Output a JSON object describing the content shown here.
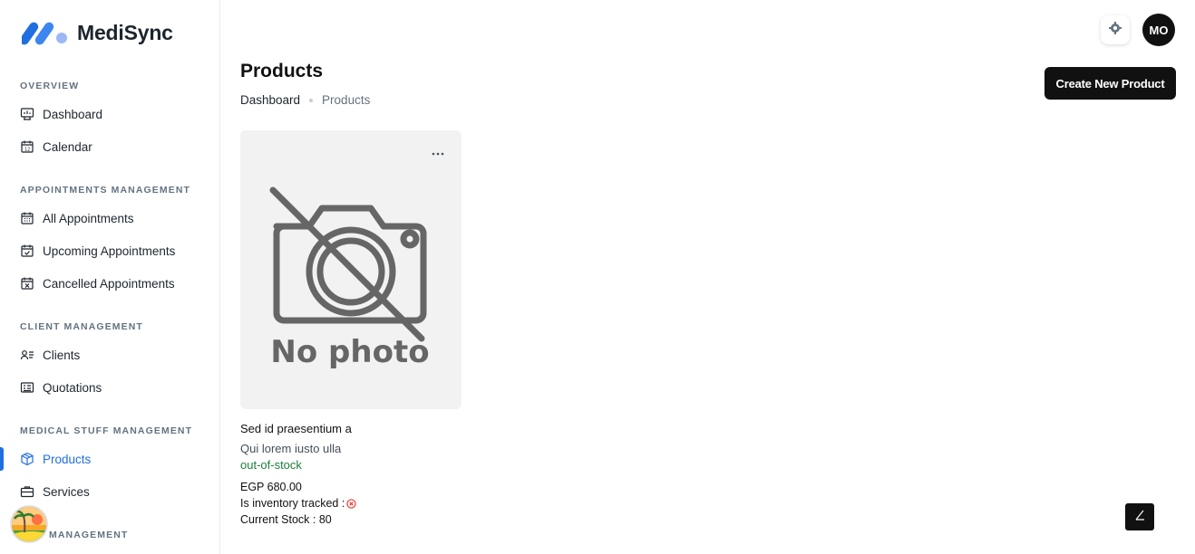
{
  "brand": {
    "name": "MediSync",
    "accent": "#1f6fe0"
  },
  "sidebar": {
    "sections": [
      {
        "label": "OVERVIEW"
      },
      {
        "label": "APPOINTMENTS MANAGEMENT"
      },
      {
        "label": "CLIENT MANAGEMENT"
      },
      {
        "label": "MEDICAL STUFF MANAGEMENT"
      },
      {
        "label": "MANAGEMENT"
      }
    ],
    "items": [
      {
        "label": "Dashboard",
        "icon": "dashboard-icon"
      },
      {
        "label": "Calendar",
        "icon": "calendar-icon"
      },
      {
        "label": "All Appointments",
        "icon": "calendar-grid-icon"
      },
      {
        "label": "Upcoming Appointments",
        "icon": "calendar-check-icon"
      },
      {
        "label": "Cancelled Appointments",
        "icon": "calendar-x-icon"
      },
      {
        "label": "Clients",
        "icon": "users-list-icon"
      },
      {
        "label": "Quotations",
        "icon": "quotation-icon"
      },
      {
        "label": "Products",
        "icon": "box-icon",
        "active": true
      },
      {
        "label": "Services",
        "icon": "briefcase-icon"
      }
    ]
  },
  "header": {
    "avatar_initials": "MO",
    "settings_icon": "gear-icon"
  },
  "page": {
    "title": "Products",
    "breadcrumb": [
      "Dashboard",
      "Products"
    ],
    "create_button": "Create New Product"
  },
  "products": [
    {
      "name": "Sed id praesentium a",
      "description": "Qui lorem iusto ulla",
      "status": "out-of-stock",
      "status_color": "#1b7f3a",
      "price": "EGP 680.00",
      "inventory_label": "Is inventory tracked :",
      "inventory_tracked": false,
      "stock": "Current Stock : 80",
      "image_placeholder": "No photo"
    }
  ]
}
